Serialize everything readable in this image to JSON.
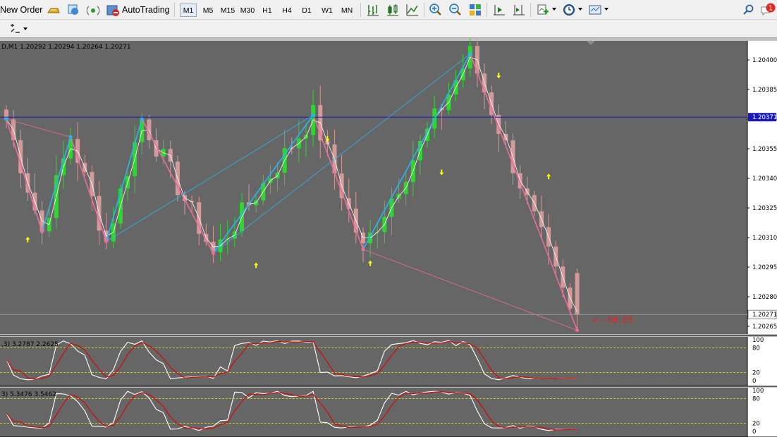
{
  "toolbar": {
    "new_order_label": "New Order",
    "autotrading_label": "AutoTrading",
    "timeframes": [
      "M1",
      "M5",
      "M15",
      "M30",
      "H1",
      "H4",
      "D1",
      "W1",
      "MN"
    ],
    "active_timeframe": "M1",
    "notification_count": "1"
  },
  "chart": {
    "header_text": "D,M1  1.20292 1.20294 1.20264 1.20271",
    "price_labels": [
      "1.20400",
      "1.20385",
      "1.20370",
      "1.20355",
      "1.20340",
      "1.20325",
      "1.20310",
      "1.20295",
      "1.20280",
      "1.20265"
    ],
    "hline_price_label": "1.20371",
    "current_price_label": "1.20271",
    "countdown_text": "<--00:05",
    "colors": {
      "background": "#666666",
      "bull_candle": "#2fd62f",
      "bear_candle": "#d49a9a",
      "zigzag_blue": "#27b6f0",
      "zigzag_pink": "#ee6b9a",
      "hline": "#1a1ab8",
      "signal_arrow": "#ffff00",
      "countdown": "#e02020"
    }
  },
  "indicator1": {
    "header_text": ",3) 3.2787 2.2625",
    "level_labels": [
      "100",
      "80",
      "20",
      "0"
    ]
  },
  "indicator2": {
    "header_text": "3) 5.3476 3.5462",
    "level_labels": [
      "100",
      "80",
      "20",
      "0"
    ]
  },
  "chart_data": {
    "type": "candlestick",
    "symbol_timeframe": "M1",
    "last_bar": {
      "open": 1.20292,
      "high": 1.20294,
      "low": 1.20264,
      "close": 1.20271
    },
    "price_axis_range": [
      1.2026,
      1.20405
    ],
    "horizontal_line": 1.20371,
    "current_price": 1.20271,
    "zigzag_points": [
      {
        "bar": 0,
        "price": 1.2037
      },
      {
        "bar": 5,
        "price": 1.20313
      },
      {
        "bar": 9,
        "price": 1.20361
      },
      {
        "bar": 14,
        "price": 1.20308
      },
      {
        "bar": 19,
        "price": 1.2037
      },
      {
        "bar": 29,
        "price": 1.20302
      },
      {
        "bar": 43,
        "price": 1.20372
      },
      {
        "bar": 50,
        "price": 1.20304
      },
      {
        "bar": 65,
        "price": 1.20403
      },
      {
        "bar": 80,
        "price": 1.20263
      }
    ],
    "indicator1": {
      "name": "stochastic",
      "values": [
        3.2787,
        2.2625
      ],
      "levels": [
        80,
        20
      ]
    },
    "indicator2": {
      "name": "stochastic",
      "values": [
        5.3476,
        3.5462
      ],
      "levels": [
        80,
        20
      ]
    }
  }
}
